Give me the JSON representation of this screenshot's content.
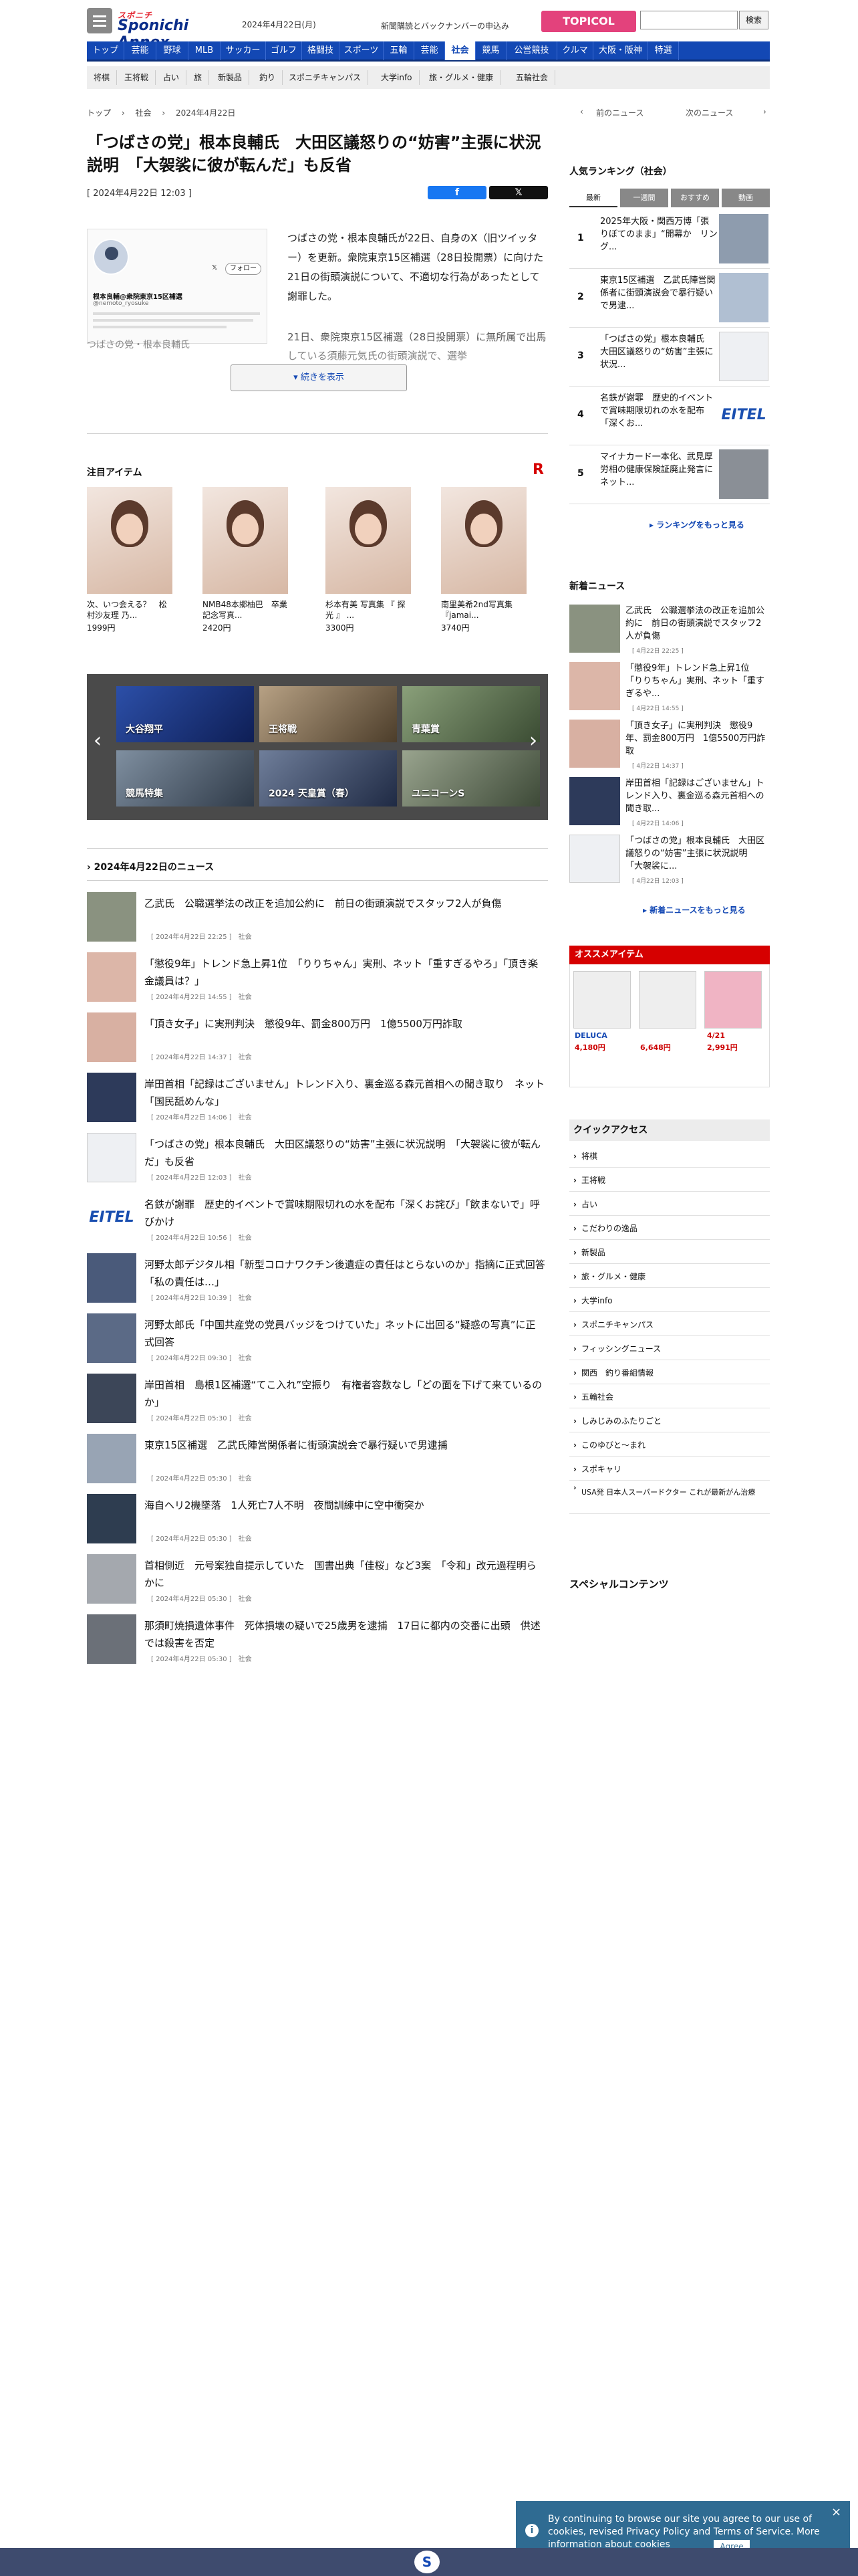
{
  "header": {
    "logo_top": "スポニチ",
    "logo": "Sponichi Annex",
    "date": "2024年4月22日(月)",
    "news_link": "新聞購読とバックナンバーの申込み",
    "topicol": "TOPICOL",
    "search_button": "検索"
  },
  "nav": [
    "トップ",
    "芸能",
    "野球",
    "MLB",
    "サッカー",
    "ゴルフ",
    "格闘技",
    "スポーツ",
    "五輪",
    "芸能",
    "社会",
    "競馬",
    "公営競技",
    "クルマ",
    "大阪・阪神",
    "特選"
  ],
  "subnav": [
    "将棋",
    "王将戦",
    "占い",
    "旅",
    "新製品",
    "釣り",
    "スポニチキャンパス",
    "大学info",
    "旅・グルメ・健康",
    "五輪社会"
  ],
  "breadcrumb": [
    "トップ",
    "社会",
    "2024年4月22日"
  ],
  "prev_news": "前のニュース",
  "next_news": "次のニュース",
  "article": {
    "title": "「つばさの党」根本良輔氏　大田区議怒りの“妨害”主張に状況説明　「大袈裟に彼が転んだ」も反省",
    "date": "[ 2024年4月22日 12:03 ]",
    "lede": "つばさの党・根本良輔氏が22日、自身のX（旧ツイッター）を更新。衆院東京15区補選（28日投開票）に向けた21日の街頭演説について、不適切な行為があったとして謝罪した。",
    "p2": "21日、衆院東京15区補選（28日投開票）に無所属で出馬している須藤元気氏の街頭演説で、選挙",
    "fade": "つばさの党・根本良輔氏",
    "more": "続きを表示",
    "embed_name": "根本良輔@衆院東京15区補選",
    "embed_handle": "@nemoto_ryosuke",
    "follow": "フォロー"
  },
  "featured": {
    "heading": "注目アイテム",
    "badge": "R",
    "items": [
      {
        "title": "次、いつ会える？　松村沙友理 乃...",
        "price": "1999円"
      },
      {
        "title": "NMB48本郷柚巴　卒業記念写真...",
        "price": "2420円"
      },
      {
        "title": "杉本有美 写真集 『 探光 』 ...",
        "price": "3300円"
      },
      {
        "title": "南里美希2nd写真集『jamai...",
        "price": "3740円"
      }
    ]
  },
  "carousel": [
    "大谷翔平",
    "王将戦",
    "青葉賞",
    "競馬特集",
    "2024 天皇賞（春）",
    "ユニコーンS"
  ],
  "newslist": {
    "heading": "2024年4月22日のニュース",
    "items": [
      {
        "title": "乙武氏　公職選挙法の改正を追加公約に　前日の街頭演説でスタッフ2人が負傷",
        "meta": "[ 2024年4月22日 22:25 ]　社会"
      },
      {
        "title": "「懲役9年」トレンド急上昇1位　「りりちゃん」実刑、ネット「重すぎるやろ」「頂き楽金議員は？」",
        "meta": "[ 2024年4月22日 14:55 ]　社会"
      },
      {
        "title": "「頂き女子」に実刑判決　懲役9年、罰金800万円　1億5500万円詐取",
        "meta": "[ 2024年4月22日 14:37 ]　社会"
      },
      {
        "title": "岸田首相「記録はございません」トレンド入り、裏金巡る森元首相への聞き取り　ネット「国民舐めんな」",
        "meta": "[ 2024年4月22日 14:06 ]　社会"
      },
      {
        "title": "「つばさの党」根本良輔氏　大田区議怒りの“妨害”主張に状況説明　「大袈裟に彼が転んだ」も反省",
        "meta": "[ 2024年4月22日 12:03 ]　社会"
      },
      {
        "title": "名鉄が謝罪　歴史的イベントで賞味期限切れの水を配布「深くお詫び」「飲まないで」呼びかけ",
        "meta": "[ 2024年4月22日 10:56 ]　社会"
      },
      {
        "title": "河野太郎デジタル相「新型コロナワクチン後遺症の責任はとらないのか」指摘に正式回答「私の責任は…」",
        "meta": "[ 2024年4月22日 10:39 ]　社会"
      },
      {
        "title": "河野太郎氏「中国共産党の党員バッジをつけていた」ネットに出回る“疑惑の写真”に正式回答",
        "meta": "[ 2024年4月22日 09:30 ]　社会"
      },
      {
        "title": "岸田首相　島根1区補選“てこ入れ”空振り　有権者容数なし「どの面を下げて来ているのか」",
        "meta": "[ 2024年4月22日 05:30 ]　社会"
      },
      {
        "title": "東京15区補選　乙武氏陣営関係者に街頭演説会で暴行疑いで男逮捕",
        "meta": "[ 2024年4月22日 05:30 ]　社会"
      },
      {
        "title": "海自ヘリ2機墜落　1人死亡7人不明　夜間訓練中に空中衝突か",
        "meta": "[ 2024年4月22日 05:30 ]　社会"
      },
      {
        "title": "首相側近　元号案独自提示していた　国書出典「佳桜」など3案　「令和」改元過程明らかに",
        "meta": "[ 2024年4月22日 05:30 ]　社会"
      },
      {
        "title": "那須町焼損遺体事件　死体損壊の疑いで25歳男を逮捕　17日に都内の交番に出頭　供述では殺害を否定",
        "meta": "[ 2024年4月22日 05:30 ]　社会"
      }
    ]
  },
  "ranking": {
    "heading": "人気ランキング（社会）",
    "tabs": [
      "最新",
      "一週間",
      "おすすめ",
      "動画"
    ],
    "items": [
      {
        "rank": "1",
        "title": "2025年大阪・関西万博「張りぼてのまま」“開幕か　リング..."
      },
      {
        "rank": "2",
        "title": "東京15区補選　乙武氏陣営関係者に街頭演説会で暴行疑いで男逮..."
      },
      {
        "rank": "3",
        "title": "「つばさの党」根本良輔氏　大田区議怒りの“妨害”主張に状況..."
      },
      {
        "rank": "4",
        "title": "名鉄が謝罪　歴史的イベントで賞味期限切れの水を配布「深くお..."
      },
      {
        "rank": "5",
        "title": "マイナカード一本化、武見厚労相の健康保険証廃止発言にネット..."
      }
    ],
    "more": "ランキングをもっと見る"
  },
  "latest": {
    "heading": "新着ニュース",
    "items": [
      {
        "title": "乙武氏　公職選挙法の改正を追加公約に　前日の街頭演説でスタッフ2人が負傷",
        "date": "[ 4月22日 22:25 ]"
      },
      {
        "title": "「懲役9年」トレンド急上昇1位　「りりちゃん」実刑、ネット「重すぎるや...",
        "date": "[ 4月22日 14:55 ]"
      },
      {
        "title": "「頂き女子」に実刑判決　懲役9年、罰金800万円　1億5500万円詐取",
        "date": "[ 4月22日 14:37 ]"
      },
      {
        "title": "岸田首相「記録はございません」トレンド入り、裏金巡る森元首相への聞き取...",
        "date": "[ 4月22日 14:06 ]"
      },
      {
        "title": "「つばさの党」根本良輔氏　大田区議怒りの“妨害”主張に状況説明　「大袈裟に...",
        "date": "[ 4月22日 12:03 ]"
      }
    ],
    "more": "新着ニュースをもっと見る"
  },
  "ad": {
    "heading": "オススメアイテム",
    "items": [
      {
        "label": "DELUCA",
        "price": "4,180円"
      },
      {
        "label": "",
        "price": "6,648円"
      },
      {
        "label": "4/21",
        "price": "2,991円"
      }
    ]
  },
  "quick": {
    "heading": "クイックアクセス",
    "items": [
      "将棋",
      "王将戦",
      "占い",
      "こだわりの逸品",
      "新製品",
      "旅・グルメ・健康",
      "大学info",
      "スポニチキャンパス",
      "フィッシングニュース",
      "関西　釣り番組情報",
      "五輪社会",
      "しみじみのふたりごと",
      "このゆびと～まれ",
      "スポキャリ",
      "USA発 日本人スーパードクター これが最新がん治療"
    ]
  },
  "special": "スペシャルコンテンツ",
  "cookie": {
    "text": "By continuing to browse our site you agree to our use of cookies, revised Privacy Policy and Terms of Service. More information about cookies",
    "agree": "Agree"
  },
  "colors": {
    "brand": "#1348b4",
    "accent": "#e3222e",
    "topicol": "#e3427c"
  }
}
